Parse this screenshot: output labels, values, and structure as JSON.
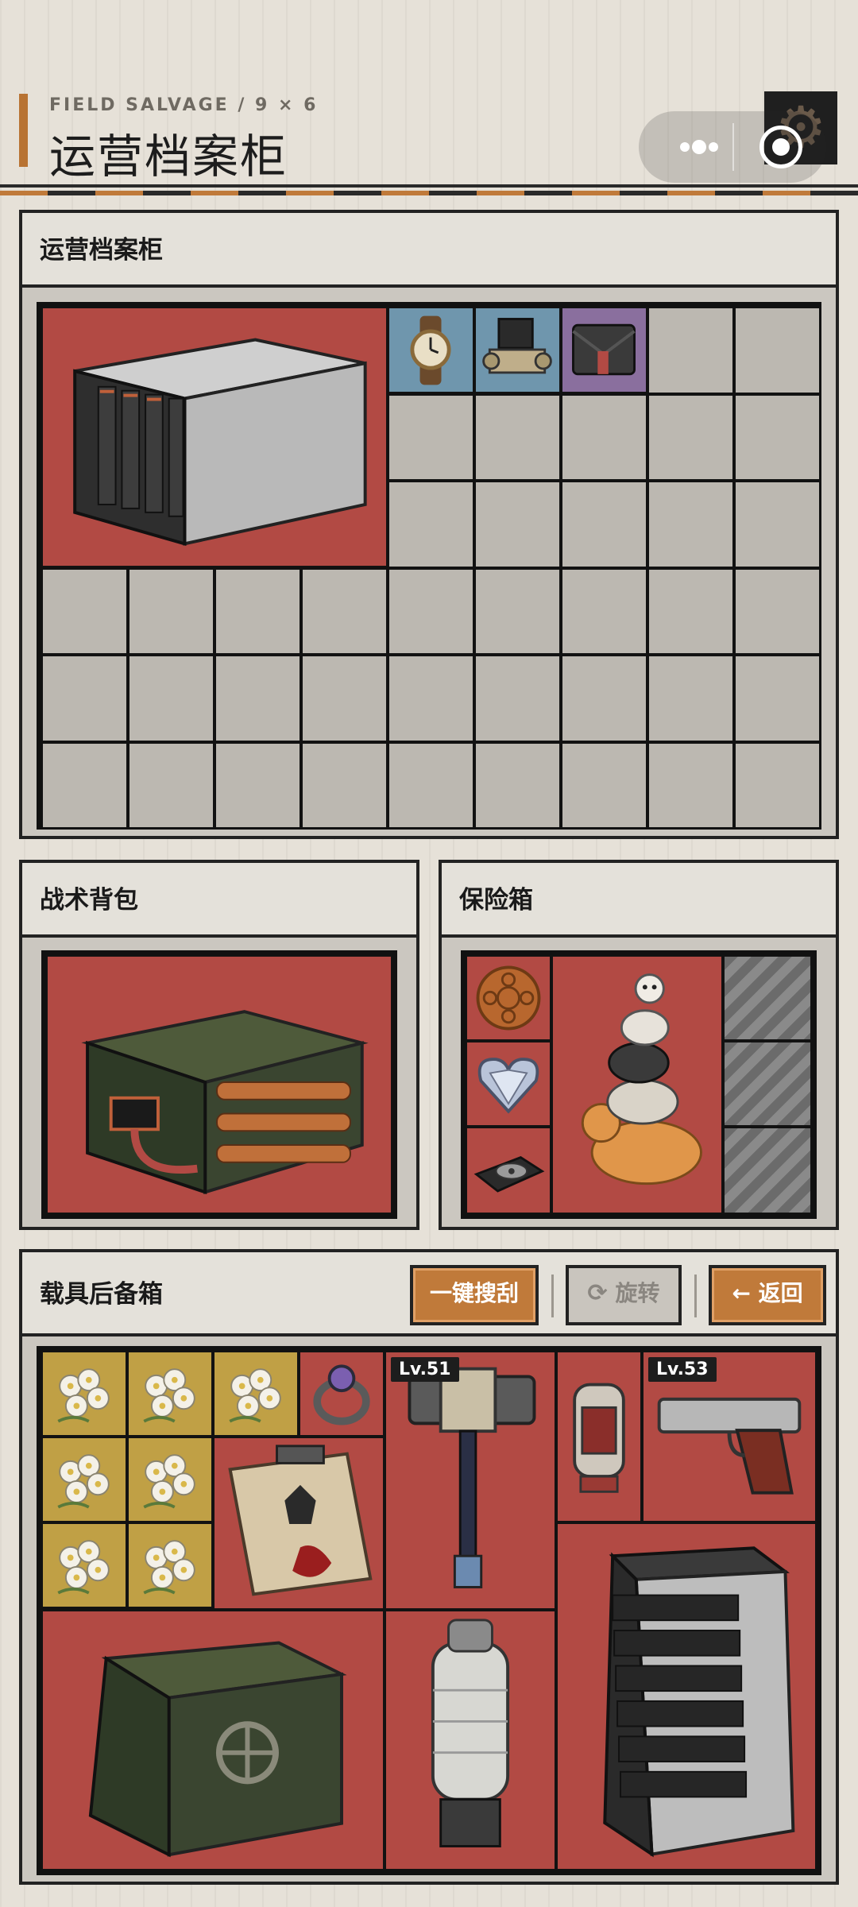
{
  "header": {
    "subtitle": "FIELD SALVAGE / 9 × 6",
    "title": "运营档案柜"
  },
  "capsule": {
    "more_icon": "more-dots-icon",
    "close_icon": "target-close-icon"
  },
  "panels": {
    "archive": {
      "title": "运营档案柜"
    },
    "backpack": {
      "title": "战术背包"
    },
    "safebox": {
      "title": "保险箱"
    },
    "trunk": {
      "title": "载具后备箱"
    }
  },
  "trunk_buttons": {
    "loot_all": "一键搜刮",
    "rotate": "旋转",
    "back": "返回"
  },
  "levels": {
    "hammer": "Lv.51",
    "pistol": "Lv.53"
  },
  "colors": {
    "accent": "#b87333",
    "rarity_red": "#b24a44",
    "rarity_blue": "#6f96ad",
    "rarity_purple": "#8a6f9e",
    "rarity_gold": "#c0a045",
    "empty_cell": "#bcb8b1"
  },
  "items": {
    "archive": [
      {
        "name": "nas-server",
        "rarity": "red"
      },
      {
        "name": "wristwatch",
        "rarity": "blue"
      },
      {
        "name": "solenoid-valve",
        "rarity": "blue"
      },
      {
        "name": "document-pouch",
        "rarity": "purple"
      }
    ],
    "backpack": [
      {
        "name": "battery-pack",
        "rarity": "red"
      }
    ],
    "safebox": [
      {
        "name": "mooncake",
        "rarity": "red"
      },
      {
        "name": "heart-diamond",
        "rarity": "red"
      },
      {
        "name": "hard-drive",
        "rarity": "red"
      },
      {
        "name": "cat-tower",
        "rarity": "red"
      }
    ],
    "trunk": [
      {
        "name": "jasmine-flower",
        "rarity": "gold"
      },
      {
        "name": "gem-ring",
        "rarity": "red"
      },
      {
        "name": "war-hammer",
        "rarity": "red"
      },
      {
        "name": "capsule-canister",
        "rarity": "red"
      },
      {
        "name": "pistol",
        "rarity": "red"
      },
      {
        "name": "bloody-dossier",
        "rarity": "red"
      },
      {
        "name": "armored-safe",
        "rarity": "red"
      },
      {
        "name": "drill-motor",
        "rarity": "red"
      },
      {
        "name": "nas-server",
        "rarity": "red"
      }
    ]
  }
}
